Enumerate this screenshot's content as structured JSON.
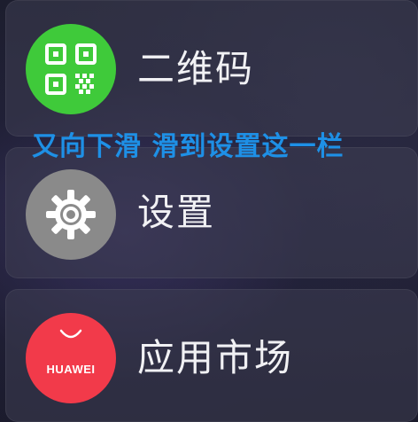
{
  "items": [
    {
      "label": "二维码",
      "icon": "qr-code-icon",
      "color": "#3fca3a"
    },
    {
      "label": "设置",
      "icon": "gear-icon",
      "color": "#8a8a8a"
    },
    {
      "label": "应用市场",
      "icon": "huawei-appgallery-icon",
      "color": "#f23a4a",
      "icon_text": "HUAWEI"
    }
  ],
  "annotation": "又向下滑 滑到设置这一栏",
  "annotation_color": "#1e90e6"
}
